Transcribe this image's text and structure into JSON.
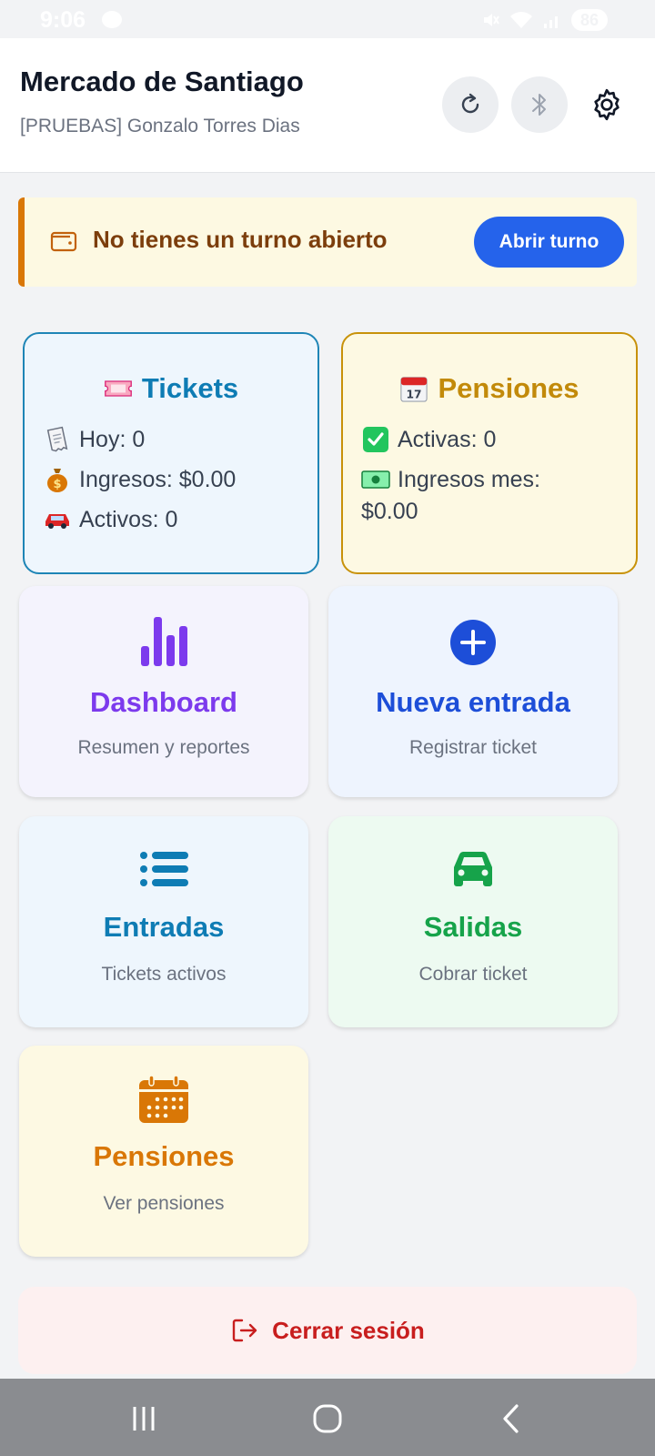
{
  "status_bar": {
    "time": "9:06",
    "battery": "86"
  },
  "header": {
    "title": "Mercado de Santiago",
    "subtitle": "[PRUEBAS] Gonzalo Torres Dias",
    "icons": [
      "refresh-icon",
      "bluetooth-icon",
      "gear-icon"
    ]
  },
  "alert": {
    "text": "No tienes un turno abierto",
    "button": "Abrir turno",
    "icon": "wallet-icon",
    "accent": "#d97706"
  },
  "stats": {
    "tickets": {
      "title": "Tickets",
      "icon": "ticket-emoji",
      "lines": [
        "Hoy: 0",
        "Ingresos: $0.00",
        "Activos: 0"
      ],
      "line_icons": [
        "receipt-emoji",
        "money-bag-emoji",
        "car-emoji"
      ],
      "color": "#0e7cb4"
    },
    "pensiones": {
      "title": "Pensiones",
      "icon": "calendar-emoji",
      "line1": "Activas: 0",
      "line2": "Ingresos mes:",
      "line2_value": "$0.00",
      "line_icons": [
        "check-mark-emoji",
        "banknote-emoji"
      ],
      "color": "#c28a0a"
    }
  },
  "cards": [
    {
      "title": "Dashboard",
      "subtitle": "Resumen y reportes",
      "icon": "bar-chart-icon",
      "color": "#7c3aed"
    },
    {
      "title": "Nueva entrada",
      "subtitle": "Registrar ticket",
      "icon": "plus-circle-icon",
      "color": "#1d4ed8"
    },
    {
      "title": "Entradas",
      "subtitle": "Tickets activos",
      "icon": "list-icon",
      "color": "#0e7cb4"
    },
    {
      "title": "Salidas",
      "subtitle": "Cobrar ticket",
      "icon": "car-icon",
      "color": "#16a34a"
    },
    {
      "title": "Pensiones",
      "subtitle": "Ver pensiones",
      "icon": "calendar-icon",
      "color": "#d97706"
    }
  ],
  "logout": {
    "label": "Cerrar sesión",
    "icon": "logout-icon",
    "color": "#c81e1e"
  },
  "nav": [
    "recent-apps-icon",
    "home-icon",
    "back-icon"
  ]
}
